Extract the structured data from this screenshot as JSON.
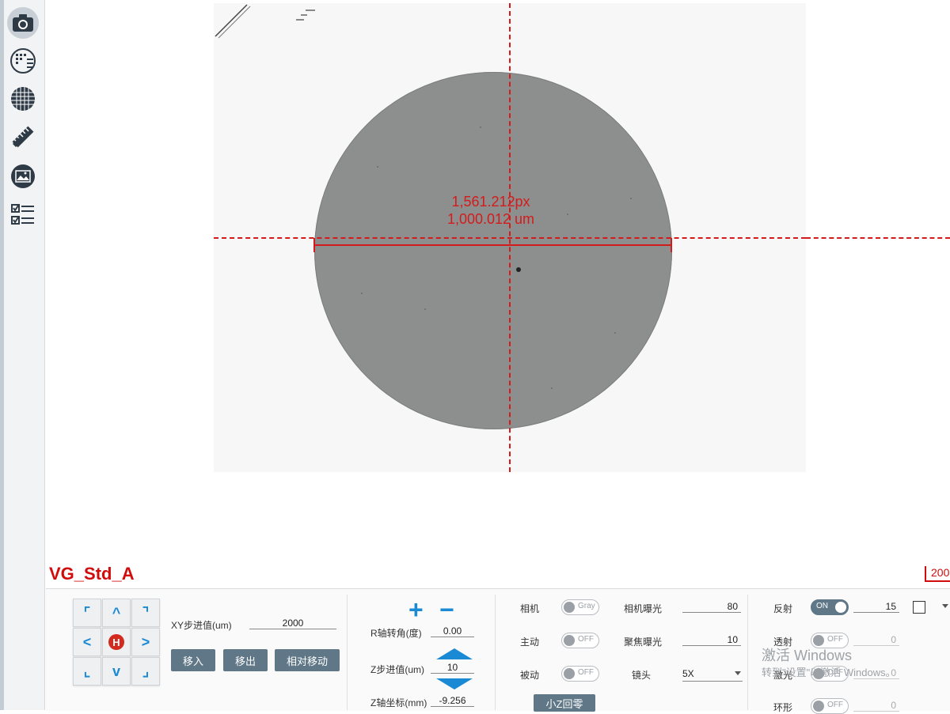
{
  "sidebar": {
    "icons": [
      "camera-icon",
      "wafer-map-icon",
      "grid-icon",
      "ruler-tools-icon",
      "image-gallery-icon",
      "checklist-icon"
    ]
  },
  "viewer": {
    "measure_px": "1,561.212px",
    "measure_um": "1,000.012 um",
    "recipe_name": "VG_Std_A",
    "scale_bar": "200",
    "colors": {
      "overlay": "#d41b1b",
      "recipe": "#d10c0c",
      "circle": "#8d8f8f"
    }
  },
  "motion": {
    "xy_step_label": "XY步进值(um)",
    "xy_step_value": "2000",
    "move_in": "移入",
    "move_out": "移出",
    "relative_move": "相对移动",
    "home_label": "H",
    "r_angle_label": "R轴转角(度)",
    "r_angle_value": "0.00",
    "z_step_label": "Z步进值(um)",
    "z_step_value": "10",
    "z_coord_label": "Z轴坐标(mm)",
    "z_coord_value": "-9.256",
    "plus": "+",
    "minus": "−"
  },
  "camera": {
    "camera_label": "相机",
    "camera_toggle": "Gray",
    "active_label": "主动",
    "active_toggle": "OFF",
    "passive_label": "被动",
    "passive_toggle": "OFF",
    "exposure_label": "相机曝光",
    "exposure_value": "80",
    "focus_exposure_label": "聚焦曝光",
    "focus_exposure_value": "10",
    "lens_label": "镜头",
    "lens_value": "5X",
    "small_z_zero": "小Z回零"
  },
  "lighting": {
    "reflect_label": "反射",
    "reflect_toggle": "ON",
    "reflect_value": "15",
    "transmit_label": "透射",
    "transmit_toggle": "OFF",
    "transmit_value": "0",
    "laser_label": "激光",
    "laser_toggle": "OFF",
    "laser_value": "0",
    "ring_label": "环形",
    "ring_toggle": "OFF",
    "ring_value": "0"
  },
  "watermark": {
    "line1": "激活 Windows",
    "line2": "转到\"设置\"以激活 Windows。"
  }
}
